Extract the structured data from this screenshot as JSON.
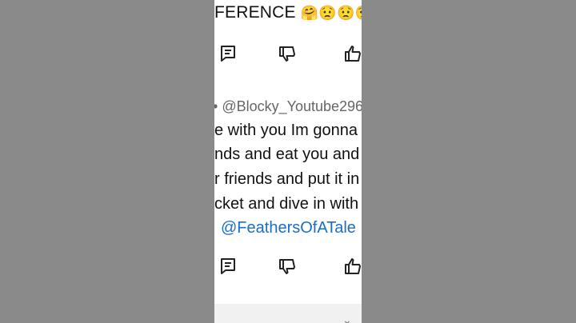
{
  "top_comment": {
    "text": "FERENCE",
    "emojis": [
      "🤗",
      "😟",
      "😟",
      "😟"
    ]
  },
  "comment": {
    "bullet": "•",
    "handle": "@Blocky_Youtube296",
    "lines": [
      "e with you Im gonna",
      "nds and eat you and",
      "r friends and put it in",
      "cket and dive in with"
    ],
    "mention": "@FeathersOfATale"
  },
  "icons": {
    "reply": "reply-icon",
    "dislike": "thumbs-down-icon",
    "like": "thumbs-up-icon"
  },
  "colors": {
    "background": "#8a8a8a",
    "panel": "#ffffff",
    "mention": "#1d6ec2",
    "handle": "#666666"
  }
}
